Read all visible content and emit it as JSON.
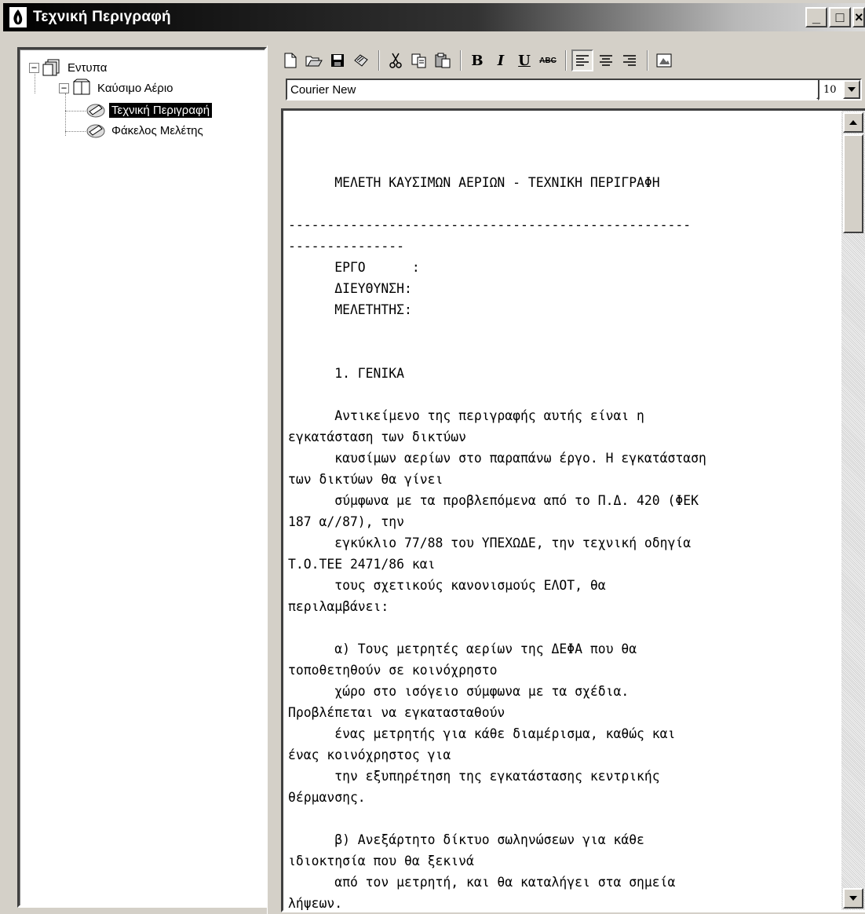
{
  "window": {
    "title": "Τεχνική Περιγραφή",
    "app_icon": "flame-icon",
    "buttons": {
      "minimize": "_",
      "maximize": "□",
      "close": "×"
    }
  },
  "tree": {
    "root": {
      "label": "Εντυπα",
      "icon": "folder-stack-icon"
    },
    "child": {
      "label": "Καύσιμο Αέριο",
      "icon": "book-icon"
    },
    "leaves": [
      {
        "label": "Τεχνική Περιγραφή",
        "icon": "document-icon",
        "selected": true
      },
      {
        "label": "Φάκελος Μελέτης",
        "icon": "document-icon",
        "selected": false
      }
    ]
  },
  "toolbar": {
    "new": "new-document-icon",
    "open": "open-folder-icon",
    "save": "save-disk-icon",
    "print": "print-icon",
    "cut": "cut-icon",
    "copy": "copy-icon",
    "paste": "paste-icon",
    "bold": "B",
    "italic": "I",
    "underline": "U",
    "strike": "ABC",
    "align_left": "align-left-icon",
    "align_center": "align-center-icon",
    "align_right": "align-right-icon",
    "insert": "insert-image-icon"
  },
  "font": {
    "family": "Courier New",
    "size": "10"
  },
  "document": {
    "lines": [
      "      ΜΕΛΕΤΗ ΚΑΥΣΙΜΩΝ ΑΕΡΙΩΝ - ΤΕΧΝΙΚΗ ΠΕΡΙΓΡΑΦΗ",
      "",
      "----------------------------------------------------",
      "---------------",
      "      ΕΡΓΟ      :",
      "      ΔΙΕΥΘΥΝΣΗ:",
      "      ΜΕΛΕΤΗΤΗΣ:",
      "",
      "",
      "      1. ΓΕΝΙΚΑ",
      "",
      "      Αντικείμενο της περιγραφής αυτής είναι η",
      "εγκατάσταση των δικτύων",
      "      καυσίμων αερίων στο παραπάνω έργο. Η εγκατάσταση",
      "των δικτύων θα γίνει",
      "      σύμφωνα με τα προβλεπόμενα από το Π.Δ. 420 (ΦΕΚ",
      "187 α//87), την",
      "      εγκύκλιο 77/88 του ΥΠΕΧΩΔΕ, την τεχνική οδηγία",
      "Τ.Ο.ΤΕΕ 2471/86 και",
      "      τους σχετικούς κανονισμούς ΕΛΟΤ, θα",
      "περιλαμβάνει:",
      "",
      "      α) Τους μετρητές αερίων της ΔΕΦΑ που θα",
      "τοποθετηθούν σε κοινόχρηστο",
      "      χώρο στο ισόγειο σύμφωνα με τα σχέδια.",
      "Προβλέπεται να εγκατασταθούν",
      "      ένας μετρητής για κάθε διαμέρισμα, καθώς και",
      "ένας κοινόχρηστος για",
      "      την εξυπηρέτηση της εγκατάστασης κεντρικής",
      "θέρμανσης.",
      "",
      "      β) Ανεξάρτητο δίκτυο σωληνώσεων για κάθε",
      "ιδιοκτησία που θα ξεκινά",
      "      από τον μετρητή, και θα καταλήγει στα σημεία",
      "λήψεων."
    ]
  }
}
